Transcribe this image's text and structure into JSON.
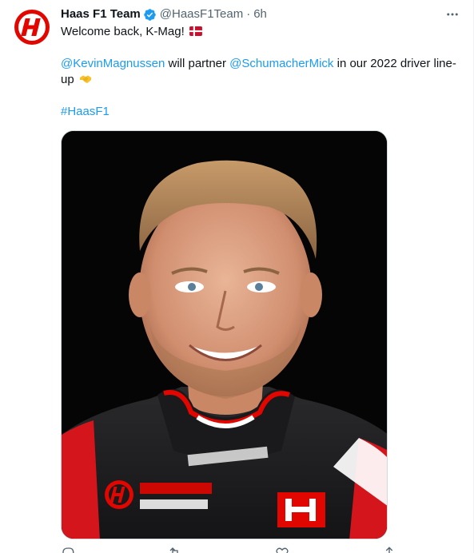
{
  "tweet": {
    "author": {
      "display_name": "Haas F1 Team",
      "handle": "@HaasF1Team",
      "verified": true,
      "avatar_icon": "haas-logo-icon"
    },
    "separator": "·",
    "time": "6h",
    "text": {
      "line1": "Welcome back, K-Mag!",
      "flag_icon": "denmark-flag-icon",
      "mention1": "@KevinMagnussen",
      "middle": " will partner ",
      "mention2": "@SchumacherMick",
      "end": " in our 2022 driver line-",
      "line3": "up",
      "emoji_icon": "handshake-icon",
      "hashtag": "#HaasF1"
    },
    "media": {
      "type": "photo",
      "subject": "driver-portrait"
    },
    "actions": {
      "reply_icon": "reply-icon",
      "retweet_icon": "retweet-icon",
      "like_icon": "like-icon",
      "share_icon": "share-icon"
    }
  },
  "colors": {
    "link": "#1d9bf0",
    "text": "#0f1419",
    "secondary": "#536471",
    "haas_red": "#e10600",
    "verified": "#1d9bf0"
  }
}
